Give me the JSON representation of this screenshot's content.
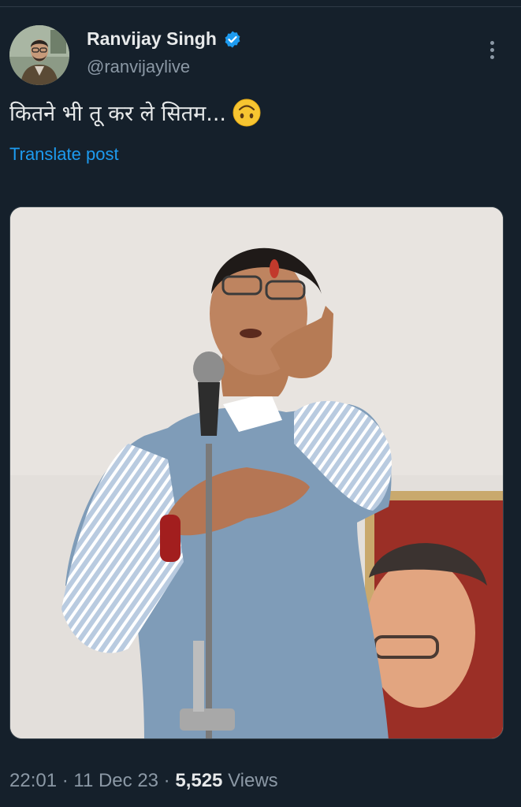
{
  "author": {
    "name": "Ranvijay Singh",
    "handle": "@ranvijaylive",
    "verified": true,
    "verified_color": "#1d9bf0"
  },
  "post": {
    "text": "कितने भी तू कर ले सितम...",
    "emoji": "upside-down-face",
    "translate_label": "Translate post",
    "media": "photo"
  },
  "meta": {
    "time": "22:01",
    "sep1": " · ",
    "date": "11 Dec 23",
    "sep2": " · ",
    "views_count": "5,525",
    "views_label": " Views"
  },
  "colors": {
    "background": "#15202b",
    "link": "#1d9bf0",
    "secondary_text": "#8b98a5"
  }
}
